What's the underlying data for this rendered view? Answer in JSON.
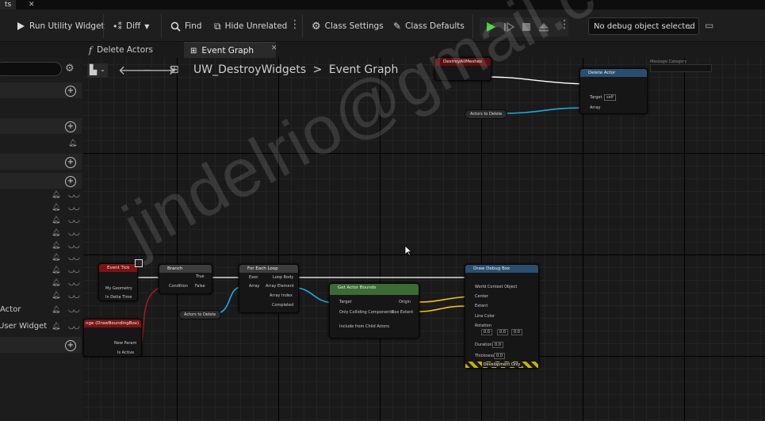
{
  "title_tab": "ts",
  "title_close": "✕",
  "toolbar": {
    "run_utility": "Run Utility Widget",
    "diff": "Diff",
    "find": "Find",
    "hide_unrelated": "Hide Unrelated",
    "class_settings": "Class Settings",
    "class_defaults": "Class Defaults",
    "debug_select": "No debug object selected"
  },
  "tabs": [
    {
      "label": "Delete Actors"
    },
    {
      "label": "Event Graph"
    }
  ],
  "breadcrumb": {
    "root": "UW_DestroyWidgets",
    "sep": ">",
    "leaf": "Event Graph"
  },
  "left_panel": {
    "rows": [
      "Actor",
      "User Widget"
    ]
  },
  "nodes": {
    "destroy_all": "DestroyAllMeshes",
    "delete_actor": {
      "title": "Delete Actor",
      "target": "Target",
      "target_value": "self",
      "array": "Array",
      "message_category": "Message Category"
    },
    "actors_to_delete_top": "Actors to Delete",
    "event_tick": {
      "title": "Event Tick",
      "my_geometry": "My Geometry",
      "in_delta_time": "In Delta Time"
    },
    "branch": {
      "title": "Branch",
      "condition": "Condition",
      "true": "True",
      "false": "False"
    },
    "foreach": {
      "title": "For Each Loop",
      "exec": "Exec",
      "array": "Array",
      "loop_body": "Loop Body",
      "array_element": "Array Element",
      "array_index": "Array Index",
      "completed": "Completed"
    },
    "actors_to_delete_bottom": "Actors to Delete",
    "get_bounds": {
      "title": "Get Actor Bounds",
      "target": "Target",
      "only_colliding": "Only Colliding Components",
      "include_child": "Include from Child Actors",
      "origin": "Origin",
      "box_extent": "Box Extent"
    },
    "draw_debug": {
      "title": "Draw Debug Box",
      "world_context": "World Context Object",
      "center": "Center",
      "extent": "Extent",
      "line_color": "Line Color",
      "rotation": "Rotation",
      "rx": "0.0",
      "ry": "0.0",
      "rz": "0.0",
      "duration": "Duration",
      "duration_value": "0.0",
      "thickness": "Thickness",
      "thickness_value": "0.0",
      "footer": "Development Only"
    },
    "bounding_box": {
      "title": "nge (DrawBoundingBox)",
      "new_param": "New Param",
      "is_active": "Is Active"
    }
  },
  "watermark": "jindelrio@gmail.c",
  "colors": {
    "exec": "#ffffff",
    "object": "#1fa8e0",
    "vector": "#f7c20c",
    "bool": "#9c1b1b",
    "event_head": "#7a1414",
    "func_head": "#2a4f6e",
    "pure_head": "#3c6a34"
  }
}
